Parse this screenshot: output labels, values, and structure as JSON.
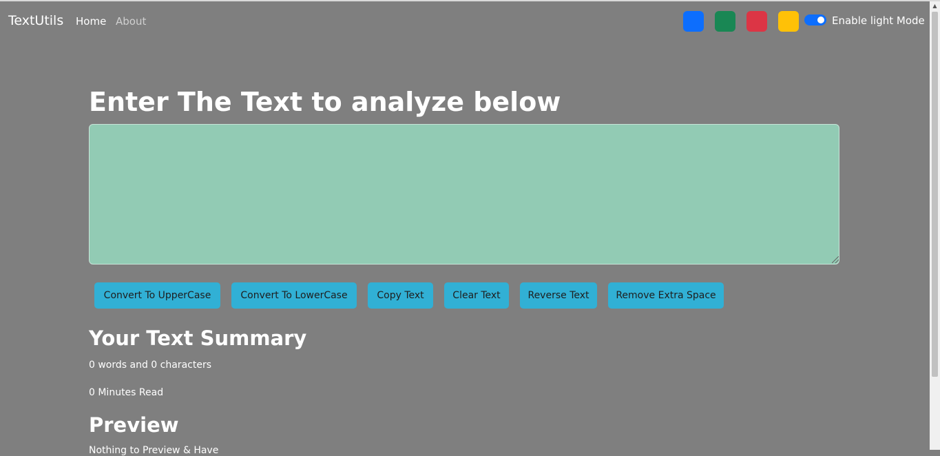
{
  "navbar": {
    "brand": "TextUtils",
    "links": [
      {
        "label": "Home"
      },
      {
        "label": "About"
      }
    ],
    "color_swatches": [
      {
        "name": "blue",
        "color": "#0d6efd"
      },
      {
        "name": "green",
        "color": "#198754"
      },
      {
        "name": "red",
        "color": "#dc3545"
      },
      {
        "name": "yellow",
        "color": "#ffc107"
      }
    ],
    "mode_toggle_label": "Enable light Mode"
  },
  "main": {
    "heading": "Enter The Text to analyze below",
    "textarea_value": "",
    "buttons": [
      {
        "label": "Convert To UpperCase"
      },
      {
        "label": "Convert To LowerCase"
      },
      {
        "label": "Copy Text"
      },
      {
        "label": "Clear Text"
      },
      {
        "label": "Reverse Text"
      },
      {
        "label": "Remove Extra Space"
      }
    ]
  },
  "summary": {
    "heading": "Your Text Summary",
    "word_char_count": "0 words and 0 characters",
    "minutes_read": "0 Minutes Read"
  },
  "preview": {
    "heading": "Preview",
    "text": "Nothing to Preview & Have"
  },
  "colors": {
    "background": "#7f7f7f",
    "textarea": "#92cbb4",
    "button": "#31b0d5"
  }
}
